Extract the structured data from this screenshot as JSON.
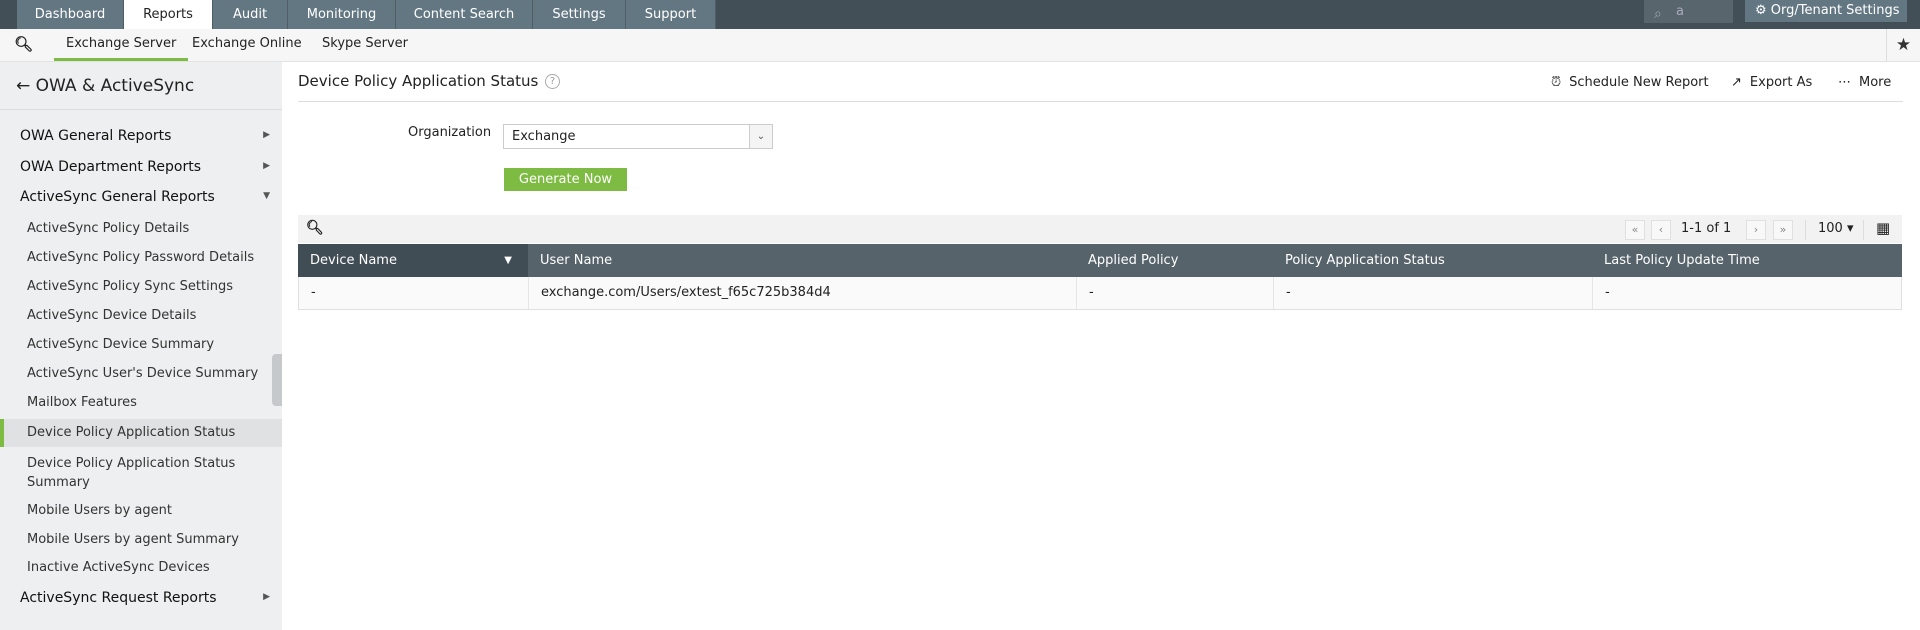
{
  "top_nav": {
    "tabs": [
      "Dashboard",
      "Reports",
      "Audit",
      "Monitoring",
      "Content Search",
      "Settings",
      "Support"
    ],
    "active": "Reports",
    "search_value": "a",
    "org_settings": "Org/Tenant Settings"
  },
  "sub_nav": {
    "tabs": [
      "Exchange Server",
      "Exchange Online",
      "Skype Server"
    ],
    "active": "Exchange Server"
  },
  "sidebar": {
    "title": "OWA & ActiveSync",
    "sections": [
      "OWA General Reports",
      "OWA Department Reports",
      "ActiveSync General Reports",
      "ActiveSync Request Reports"
    ],
    "items": [
      "ActiveSync Policy Details",
      "ActiveSync Policy Password Details",
      "ActiveSync Policy Sync Settings",
      "ActiveSync Device Details",
      "ActiveSync Device Summary",
      "ActiveSync User's Device Summary",
      "Mailbox Features",
      "Device Policy Application Status",
      "Device Policy Application Status Summary",
      "Mobile Users by agent",
      "Mobile Users by agent Summary",
      "Inactive ActiveSync Devices"
    ],
    "selected": "Device Policy Application Status"
  },
  "page": {
    "title": "Device Policy Application Status",
    "actions": {
      "schedule": "Schedule New Report",
      "export": "Export As",
      "more": "More"
    },
    "org_label": "Organization",
    "org_value": "Exchange",
    "generate": "Generate Now"
  },
  "table": {
    "pagination": "1-1 of 1",
    "page_size": "100",
    "columns": [
      "Device Name",
      "User Name",
      "Applied Policy",
      "Policy Application Status",
      "Last Policy Update Time"
    ],
    "rows": [
      [
        "-",
        "exchange.com/Users/extest_f65c725b384d4",
        "-",
        "-",
        "-"
      ]
    ]
  },
  "colors": {
    "accent": "#7dbb42",
    "topbar": "#434f57",
    "tab": "#637783"
  }
}
